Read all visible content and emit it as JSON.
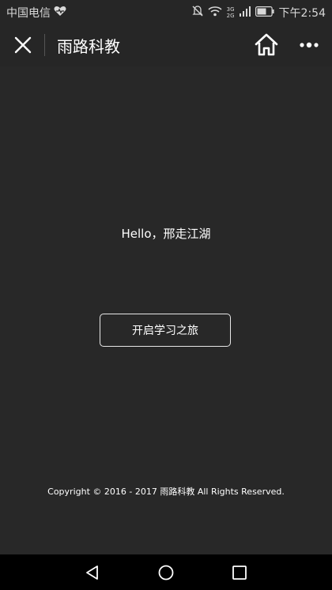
{
  "status_bar": {
    "carrier": "中国电信",
    "network_small_top": "3G",
    "network_small_bottom": "2G",
    "time": "下午2:54",
    "icons": [
      "heart-health-icon",
      "mute-icon",
      "wifi-icon",
      "signal-icon",
      "battery-icon"
    ]
  },
  "nav": {
    "title": "雨路科教",
    "icons": [
      "close-icon",
      "home-icon",
      "more-icon"
    ]
  },
  "main": {
    "greeting": "Hello，邢走江湖",
    "start_button": "开启学习之旅",
    "copyright": "Copyright © 2016 - 2017 雨路科教 All Rights Reserved."
  },
  "system_nav": {
    "icons": [
      "back-triangle-icon",
      "home-circle-icon",
      "recent-square-icon"
    ]
  },
  "colors": {
    "background": "#282828",
    "bar": "#262626",
    "bottom_bar": "#000000",
    "text": "#ffffff"
  }
}
